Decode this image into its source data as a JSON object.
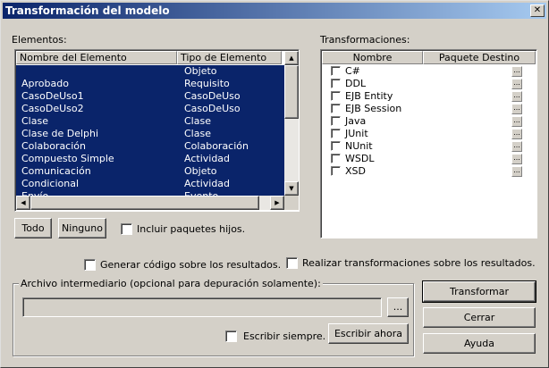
{
  "window": {
    "title": "Transformación del modelo",
    "close_glyph": "✕"
  },
  "elements": {
    "label": "Elementos:",
    "columns": [
      "Nombre del Elemento",
      "Tipo de Elemento"
    ],
    "rows": [
      {
        "name": "",
        "type": "Objeto"
      },
      {
        "name": "Aprobado",
        "type": "Requisito"
      },
      {
        "name": "CasoDeUso1",
        "type": "CasoDeUso"
      },
      {
        "name": "CasoDeUso2",
        "type": "CasoDeUso"
      },
      {
        "name": "Clase",
        "type": "Clase"
      },
      {
        "name": "Clase de Delphi",
        "type": "Clase"
      },
      {
        "name": "Colaboración",
        "type": "Colaboración"
      },
      {
        "name": "Compuesto Simple",
        "type": "Actividad"
      },
      {
        "name": "Comunicación",
        "type": "Objeto"
      },
      {
        "name": "Condicional",
        "type": "Actividad"
      },
      {
        "name": "Envío",
        "type": "Evento"
      }
    ],
    "select_all_label": "Todo",
    "select_none_label": "Ninguno",
    "include_children_label": "Incluir paquetes hijos."
  },
  "transformations": {
    "label": "Transformaciones:",
    "columns": [
      "Nombre",
      "Paquete Destino"
    ],
    "rows": [
      {
        "name": "C#",
        "checked": false
      },
      {
        "name": "DDL",
        "checked": false
      },
      {
        "name": "EJB Entity",
        "checked": false
      },
      {
        "name": "EJB Session",
        "checked": false
      },
      {
        "name": "Java",
        "checked": false
      },
      {
        "name": "JUnit",
        "checked": false
      },
      {
        "name": "NUnit",
        "checked": false
      },
      {
        "name": "WSDL",
        "checked": false
      },
      {
        "name": "XSD",
        "checked": false
      }
    ],
    "ellipsis_label": "..."
  },
  "options": {
    "generate_code_label": "Generar código sobre los resultados.",
    "perform_transforms_label": "Realizar transformaciones sobre los resultados."
  },
  "intermediate": {
    "group_title": "Archivo intermediario (opcional para depuración solamente):",
    "path_value": "",
    "browse_label": "...",
    "always_write_label": "Escribir siempre.",
    "write_now_label": "Escribir ahora"
  },
  "actions": {
    "transform_label": "Transformar",
    "close_label": "Cerrar",
    "help_label": "Ayuda"
  }
}
